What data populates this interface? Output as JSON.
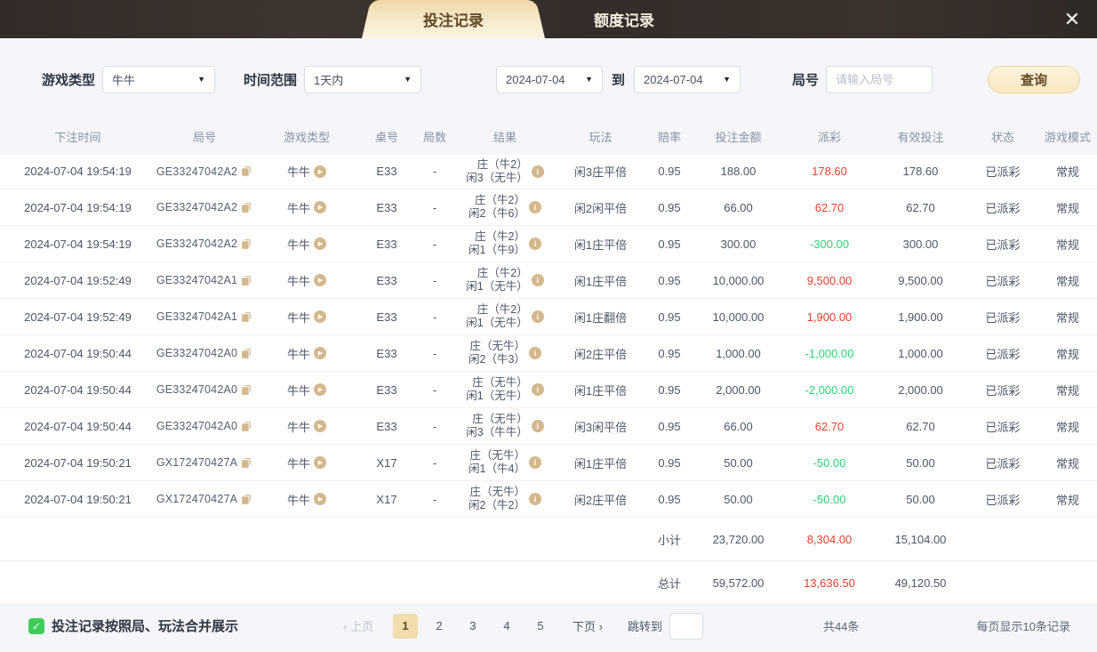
{
  "topbar": {
    "tabs": [
      {
        "label": "投注记录",
        "active": true
      },
      {
        "label": "额度记录",
        "active": false
      }
    ],
    "close_icon": "✕"
  },
  "filters": {
    "game_type_label": "游戏类型",
    "game_type_value": "牛牛",
    "time_range_label": "时间范围",
    "time_range_value": "1天内",
    "date_from": "2024-07-04",
    "to_label": "到",
    "date_to": "2024-07-04",
    "round_label": "局号",
    "round_placeholder": "请输入局号",
    "search_label": "查询"
  },
  "table": {
    "columns": [
      "下注时间",
      "局号",
      "游戏类型",
      "桌号",
      "局数",
      "结果",
      "玩法",
      "赔率",
      "投注金额",
      "派彩",
      "有效投注",
      "状态",
      "游戏模式"
    ],
    "rows": [
      {
        "time": "2024-07-04 19:54:19",
        "round": "GE33247042A2",
        "game": "牛牛",
        "table_no": "E33",
        "rounds": "-",
        "result1": "庄（牛2）",
        "result2": "闲3（无牛）",
        "play": "闲3庄平倍",
        "odds": "0.95",
        "bet": "188.00",
        "payout": "178.60",
        "payout_color": "red",
        "valid": "178.60",
        "status": "已派彩",
        "mode": "常规"
      },
      {
        "time": "2024-07-04 19:54:19",
        "round": "GE33247042A2",
        "game": "牛牛",
        "table_no": "E33",
        "rounds": "-",
        "result1": "庄（牛2）",
        "result2": "闲2（牛6）",
        "play": "闲2闲平倍",
        "odds": "0.95",
        "bet": "66.00",
        "payout": "62.70",
        "payout_color": "red",
        "valid": "62.70",
        "status": "已派彩",
        "mode": "常规"
      },
      {
        "time": "2024-07-04 19:54:19",
        "round": "GE33247042A2",
        "game": "牛牛",
        "table_no": "E33",
        "rounds": "-",
        "result1": "庄（牛2）",
        "result2": "闲1（牛9）",
        "play": "闲1庄平倍",
        "odds": "0.95",
        "bet": "300.00",
        "payout": "-300.00",
        "payout_color": "green",
        "valid": "300.00",
        "status": "已派彩",
        "mode": "常规"
      },
      {
        "time": "2024-07-04 19:52:49",
        "round": "GE33247042A1",
        "game": "牛牛",
        "table_no": "E33",
        "rounds": "-",
        "result1": "庄（牛2）",
        "result2": "闲1（无牛）",
        "play": "闲1庄平倍",
        "odds": "0.95",
        "bet": "10,000.00",
        "payout": "9,500.00",
        "payout_color": "red",
        "valid": "9,500.00",
        "status": "已派彩",
        "mode": "常规"
      },
      {
        "time": "2024-07-04 19:52:49",
        "round": "GE33247042A1",
        "game": "牛牛",
        "table_no": "E33",
        "rounds": "-",
        "result1": "庄（牛2）",
        "result2": "闲1（无牛）",
        "play": "闲1庄翻倍",
        "odds": "0.95",
        "bet": "10,000.00",
        "payout": "1,900.00",
        "payout_color": "red",
        "valid": "1,900.00",
        "status": "已派彩",
        "mode": "常规"
      },
      {
        "time": "2024-07-04 19:50:44",
        "round": "GE33247042A0",
        "game": "牛牛",
        "table_no": "E33",
        "rounds": "-",
        "result1": "庄（无牛）",
        "result2": "闲2（牛3）",
        "play": "闲2庄平倍",
        "odds": "0.95",
        "bet": "1,000.00",
        "payout": "-1,000.00",
        "payout_color": "green",
        "valid": "1,000.00",
        "status": "已派彩",
        "mode": "常规"
      },
      {
        "time": "2024-07-04 19:50:44",
        "round": "GE33247042A0",
        "game": "牛牛",
        "table_no": "E33",
        "rounds": "-",
        "result1": "庄（无牛）",
        "result2": "闲1（无牛）",
        "play": "闲1庄平倍",
        "odds": "0.95",
        "bet": "2,000.00",
        "payout": "-2,000.00",
        "payout_color": "green",
        "valid": "2,000.00",
        "status": "已派彩",
        "mode": "常规"
      },
      {
        "time": "2024-07-04 19:50:44",
        "round": "GE33247042A0",
        "game": "牛牛",
        "table_no": "E33",
        "rounds": "-",
        "result1": "庄（无牛）",
        "result2": "闲3（牛牛）",
        "play": "闲3闲平倍",
        "odds": "0.95",
        "bet": "66.00",
        "payout": "62.70",
        "payout_color": "red",
        "valid": "62.70",
        "status": "已派彩",
        "mode": "常规"
      },
      {
        "time": "2024-07-04 19:50:21",
        "round": "GX172470427A",
        "game": "牛牛",
        "table_no": "X17",
        "rounds": "-",
        "result1": "庄（无牛）",
        "result2": "闲1（牛4）",
        "play": "闲1庄平倍",
        "odds": "0.95",
        "bet": "50.00",
        "payout": "-50.00",
        "payout_color": "green",
        "valid": "50.00",
        "status": "已派彩",
        "mode": "常规"
      },
      {
        "time": "2024-07-04 19:50:21",
        "round": "GX172470427A",
        "game": "牛牛",
        "table_no": "X17",
        "rounds": "-",
        "result1": "庄（无牛）",
        "result2": "闲2（牛2）",
        "play": "闲2庄平倍",
        "odds": "0.95",
        "bet": "50.00",
        "payout": "-50.00",
        "payout_color": "green",
        "valid": "50.00",
        "status": "已派彩",
        "mode": "常规"
      }
    ],
    "subtotal": {
      "label": "小计",
      "bet": "23,720.00",
      "payout": "8,304.00",
      "payout_color": "red",
      "valid": "15,104.00"
    },
    "total": {
      "label": "总计",
      "bet": "59,572.00",
      "payout": "13,636.50",
      "payout_color": "red",
      "valid": "49,120.50"
    }
  },
  "footer": {
    "checkbox_checked": true,
    "merge_label": "投注记录按照局、玩法合并展示",
    "prev_label": "‹ 上页",
    "next_label": "下页 ›",
    "pages": [
      "1",
      "2",
      "3",
      "4",
      "5"
    ],
    "active_page": "1",
    "jump_label": "跳转到",
    "total_count": "共44条",
    "page_size": "每页显示10条记录"
  },
  "colors": {
    "accent_tan": "#d4b88d",
    "positive_red": "#ee3e31",
    "negative_green": "#2fd178",
    "checkbox_green": "#3dcd58"
  }
}
